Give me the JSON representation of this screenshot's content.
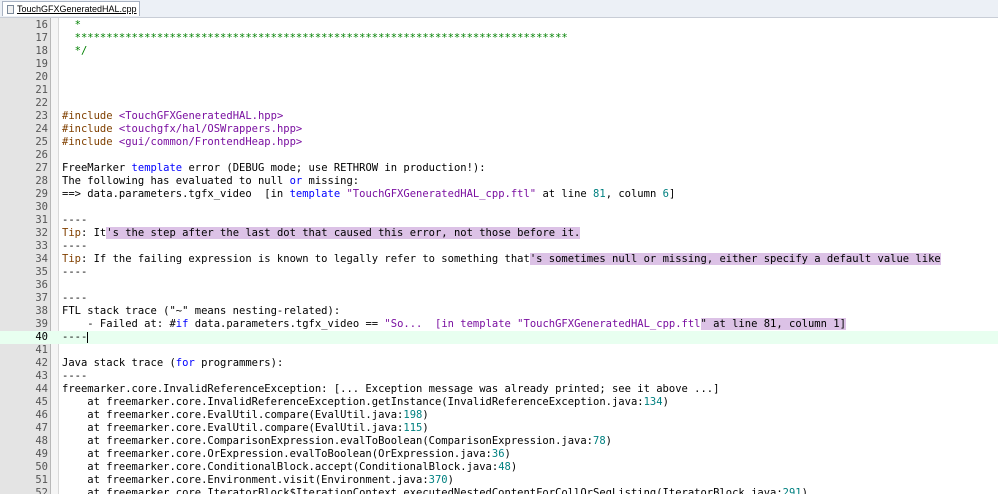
{
  "tab": {
    "filename": "TouchGFXGeneratedHAL.cpp"
  },
  "lines": [
    {
      "n": "16",
      "parts": [
        {
          "t": "  *",
          "c": "cm"
        }
      ]
    },
    {
      "n": "17",
      "parts": [
        {
          "t": "  ******************************************************************************",
          "c": "cm"
        }
      ]
    },
    {
      "n": "18",
      "parts": [
        {
          "t": "  */",
          "c": "cm"
        }
      ]
    },
    {
      "n": "19",
      "parts": []
    },
    {
      "n": "20",
      "parts": []
    },
    {
      "n": "21",
      "parts": []
    },
    {
      "n": "22",
      "parts": []
    },
    {
      "n": "23",
      "parts": [
        {
          "t": "#include ",
          "c": "p"
        },
        {
          "t": "<TouchGFXGeneratedHAL.hpp>",
          "c": "str"
        }
      ]
    },
    {
      "n": "24",
      "parts": [
        {
          "t": "#include ",
          "c": "p"
        },
        {
          "t": "<touchgfx/hal/OSWrappers.hpp>",
          "c": "str"
        }
      ]
    },
    {
      "n": "25",
      "parts": [
        {
          "t": "#include ",
          "c": "p"
        },
        {
          "t": "<gui/common/FrontendHeap.hpp>",
          "c": "str"
        }
      ]
    },
    {
      "n": "26",
      "parts": []
    },
    {
      "n": "27",
      "parts": [
        {
          "t": "FreeMarker "
        },
        {
          "t": "template",
          "c": "k"
        },
        {
          "t": " error (DEBUG mode; use RETHROW in production!):"
        }
      ]
    },
    {
      "n": "28",
      "parts": [
        {
          "t": "The following has evaluated to null "
        },
        {
          "t": "or",
          "c": "k"
        },
        {
          "t": " missing:"
        }
      ]
    },
    {
      "n": "29",
      "parts": [
        {
          "t": "==> data.parameters.tgfx_video  [in "
        },
        {
          "t": "template",
          "c": "k"
        },
        {
          "t": " "
        },
        {
          "t": "\"TouchGFXGeneratedHAL_cpp.ftl\"",
          "c": "str"
        },
        {
          "t": " at line "
        },
        {
          "t": "81",
          "c": "n"
        },
        {
          "t": ", column "
        },
        {
          "t": "6",
          "c": "n"
        },
        {
          "t": "]"
        }
      ]
    },
    {
      "n": "30",
      "parts": []
    },
    {
      "n": "31",
      "parts": [
        {
          "t": "----"
        }
      ]
    },
    {
      "n": "32",
      "parts": [
        {
          "t": "Tip",
          "c": "p"
        },
        {
          "t": ": It"
        },
        {
          "t": "'s the step after the last dot that caused this error, not those before it.",
          "c": "hl"
        }
      ]
    },
    {
      "n": "33",
      "parts": [
        {
          "t": "----"
        }
      ]
    },
    {
      "n": "34",
      "parts": [
        {
          "t": "Tip",
          "c": "p"
        },
        {
          "t": ": If the failing expression is known to legally refer to something that"
        },
        {
          "t": "'s sometimes null or missing, either specify a default value like",
          "c": "hl"
        }
      ]
    },
    {
      "n": "35",
      "parts": [
        {
          "t": "----"
        }
      ]
    },
    {
      "n": "36",
      "parts": []
    },
    {
      "n": "37",
      "parts": [
        {
          "t": "----"
        }
      ]
    },
    {
      "n": "38",
      "parts": [
        {
          "t": "FTL stack trace (\"~\" means nesting-related):"
        }
      ]
    },
    {
      "n": "39",
      "parts": [
        {
          "t": "    - Failed at: #"
        },
        {
          "t": "if",
          "c": "k"
        },
        {
          "t": " data.parameters.tgfx_video == "
        },
        {
          "t": "\"So...  [in template \"TouchGFXGeneratedHAL_cpp.ftl",
          "c": "str"
        },
        {
          "t": "\" at line 81, column 1]",
          "c": "hl"
        }
      ]
    },
    {
      "n": "40",
      "parts": [
        {
          "t": "----"
        }
      ],
      "current": true
    },
    {
      "n": "41",
      "parts": []
    },
    {
      "n": "42",
      "parts": [
        {
          "t": "Java stack trace ("
        },
        {
          "t": "for",
          "c": "k"
        },
        {
          "t": " programmers):"
        }
      ]
    },
    {
      "n": "43",
      "parts": [
        {
          "t": "----"
        }
      ]
    },
    {
      "n": "44",
      "parts": [
        {
          "t": "freemarker.core.InvalidReferenceException: [... Exception message was already printed; see it above ...]"
        }
      ]
    },
    {
      "n": "45",
      "parts": [
        {
          "t": "    at freemarker.core.InvalidReferenceException.getInstance(InvalidReferenceException.java:"
        },
        {
          "t": "134",
          "c": "n"
        },
        {
          "t": ")"
        }
      ]
    },
    {
      "n": "46",
      "parts": [
        {
          "t": "    at freemarker.core.EvalUtil.compare(EvalUtil.java:"
        },
        {
          "t": "198",
          "c": "n"
        },
        {
          "t": ")"
        }
      ]
    },
    {
      "n": "47",
      "parts": [
        {
          "t": "    at freemarker.core.EvalUtil.compare(EvalUtil.java:"
        },
        {
          "t": "115",
          "c": "n"
        },
        {
          "t": ")"
        }
      ]
    },
    {
      "n": "48",
      "parts": [
        {
          "t": "    at freemarker.core.ComparisonExpression.evalToBoolean(ComparisonExpression.java:"
        },
        {
          "t": "78",
          "c": "n"
        },
        {
          "t": ")"
        }
      ]
    },
    {
      "n": "49",
      "parts": [
        {
          "t": "    at freemarker.core.OrExpression.evalToBoolean(OrExpression.java:"
        },
        {
          "t": "36",
          "c": "n"
        },
        {
          "t": ")"
        }
      ]
    },
    {
      "n": "50",
      "parts": [
        {
          "t": "    at freemarker.core.ConditionalBlock.accept(ConditionalBlock.java:"
        },
        {
          "t": "48",
          "c": "n"
        },
        {
          "t": ")"
        }
      ]
    },
    {
      "n": "51",
      "parts": [
        {
          "t": "    at freemarker.core.Environment.visit(Environment.java:"
        },
        {
          "t": "370",
          "c": "n"
        },
        {
          "t": ")"
        }
      ]
    },
    {
      "n": "52",
      "parts": [
        {
          "t": "    at freemarker.core.IteratorBlock$IterationContext.executedNestedContentForCollOrSeqListing(IteratorBlock.java:"
        },
        {
          "t": "291",
          "c": "n"
        },
        {
          "t": ")"
        }
      ]
    }
  ]
}
